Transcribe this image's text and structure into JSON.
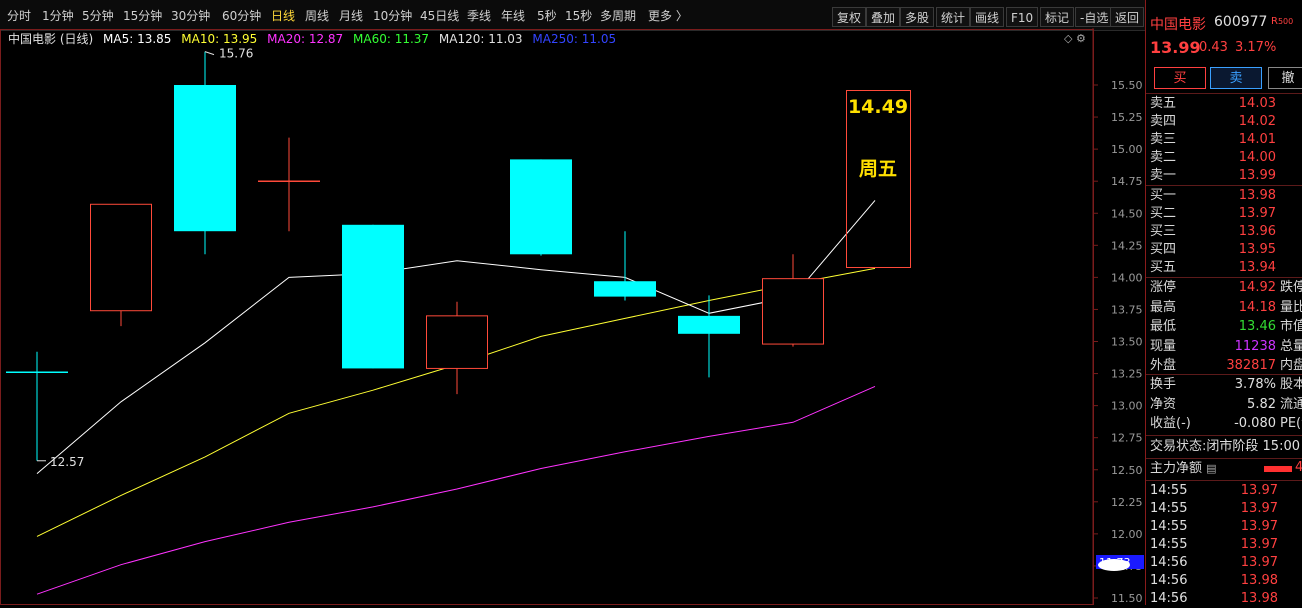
{
  "toolbar": {
    "tabs": [
      "分时",
      "1分钟",
      "5分钟",
      "15分钟",
      "30分钟",
      "60分钟",
      "日线",
      "周线",
      "月线",
      "10分钟",
      "45日线",
      "季线",
      "年线",
      "5秒",
      "15秒",
      "多周期",
      "更多 〉"
    ],
    "active_tab": "日线",
    "right_buttons": [
      "复权",
      "叠加",
      "多股",
      "统计",
      "画线",
      "F10",
      "标记",
      "-自选",
      "返回"
    ]
  },
  "legend": {
    "title": "中国电影 (日线)",
    "items": [
      {
        "text": "MA5: 13.85",
        "color": "#ffffff"
      },
      {
        "text": "MA10: 13.95",
        "color": "#ffff33"
      },
      {
        "text": "MA20: 12.87",
        "color": "#ff33ff"
      },
      {
        "text": "MA60: 11.37",
        "color": "#33ff33"
      },
      {
        "text": "MA120: 11.03",
        "color": "#e0e0e0"
      },
      {
        "text": "MA250: 11.05",
        "color": "#3333ff"
      }
    ]
  },
  "chart_data": {
    "type": "candlestick",
    "ylim": [
      11.5,
      15.75
    ],
    "y_ticks": [
      "15.50",
      "15.25",
      "15.00",
      "14.75",
      "14.50",
      "14.25",
      "14.00",
      "13.75",
      "13.50",
      "13.25",
      "13.00",
      "12.75",
      "12.50",
      "12.25",
      "12.00",
      "11.75",
      "11.50"
    ],
    "candles": [
      {
        "open": 12.57,
        "close": 13.26,
        "high": 13.42,
        "low": 12.57,
        "color": "cyan",
        "style": "cross"
      },
      {
        "open": 13.74,
        "close": 14.57,
        "high": 14.57,
        "low": 13.62,
        "color": "red"
      },
      {
        "open": 15.5,
        "close": 14.36,
        "high": 15.76,
        "low": 14.18,
        "color": "cyan"
      },
      {
        "open": 14.75,
        "close": 14.75,
        "high": 15.09,
        "low": 14.36,
        "color": "red",
        "style": "cross"
      },
      {
        "open": 14.41,
        "close": 13.29,
        "high": 14.41,
        "low": 13.29,
        "color": "cyan"
      },
      {
        "open": 13.29,
        "close": 13.7,
        "high": 13.81,
        "low": 13.09,
        "color": "red"
      },
      {
        "open": 14.92,
        "close": 14.18,
        "high": 14.92,
        "low": 14.17,
        "color": "cyan"
      },
      {
        "open": 13.97,
        "close": 13.85,
        "high": 14.36,
        "low": 13.82,
        "color": "cyan"
      },
      {
        "open": 13.7,
        "close": 13.56,
        "high": 13.86,
        "low": 13.22,
        "color": "cyan"
      },
      {
        "open": 13.48,
        "close": 13.99,
        "high": 14.18,
        "low": 13.46,
        "color": "red"
      }
    ],
    "ma5": [
      12.47,
      13.03,
      13.49,
      14.0,
      14.03,
      14.13,
      14.06,
      14.0,
      13.72,
      13.85,
      14.6
    ],
    "ma10": [
      11.98,
      12.3,
      12.6,
      12.94,
      13.12,
      13.32,
      13.54,
      13.68,
      13.82,
      13.95,
      14.07
    ],
    "ma20": [
      11.53,
      11.76,
      11.94,
      12.09,
      12.21,
      12.35,
      12.51,
      12.64,
      12.76,
      12.87,
      13.15
    ],
    "annotations": {
      "high_label": "15.76",
      "low_label": "12.57",
      "forecast_value": "14.49",
      "forecast_day": "周五"
    },
    "last_price_tag": "11.73"
  },
  "quote": {
    "name": "中国电影",
    "code": "600977",
    "badge": "R",
    "badge2": "500",
    "price": "13.99",
    "change": "0.43",
    "change_pct": "3.17%",
    "buy_btn": "买",
    "sell_btn": "卖",
    "cancel_btn": "撤",
    "asks": [
      {
        "label": "卖五",
        "price": "14.03"
      },
      {
        "label": "卖四",
        "price": "14.02"
      },
      {
        "label": "卖三",
        "price": "14.01"
      },
      {
        "label": "卖二",
        "price": "14.00"
      },
      {
        "label": "卖一",
        "price": "13.99"
      }
    ],
    "bids": [
      {
        "label": "买一",
        "price": "13.98"
      },
      {
        "label": "买二",
        "price": "13.97"
      },
      {
        "label": "买三",
        "price": "13.96"
      },
      {
        "label": "买四",
        "price": "13.95"
      },
      {
        "label": "买五",
        "price": "13.94"
      }
    ],
    "stats": [
      {
        "label": "涨停",
        "value": "14.92",
        "color": "#ff4040",
        "label2": "跌停"
      },
      {
        "label": "最高",
        "value": "14.18",
        "color": "#ff4040",
        "label2": "量比"
      },
      {
        "label": "最低",
        "value": "13.46",
        "color": "#33dd33",
        "label2": "市值"
      },
      {
        "label": "现量",
        "value": "11238",
        "color": "#cc33ff",
        "label2": "总量"
      },
      {
        "label": "外盘",
        "value": "382817",
        "color": "#ff4040",
        "label2": "内盘"
      }
    ],
    "stats2": [
      {
        "label": "换手",
        "value": "3.78%",
        "label2": "股本"
      },
      {
        "label": "净资",
        "value": "5.82",
        "label2": "流通"
      },
      {
        "label": "收益(-)",
        "value": "-0.080",
        "label2": "PE(动"
      }
    ],
    "status_label": "交易状态:",
    "status_value": "闭市阶段 15:00",
    "flow_label": "主力净额",
    "flow_value": "4",
    "ticks": [
      {
        "time": "14:55",
        "price": "13.97"
      },
      {
        "time": "14:55",
        "price": "13.97"
      },
      {
        "time": "14:55",
        "price": "13.97"
      },
      {
        "time": "14:55",
        "price": "13.97"
      },
      {
        "time": "14:56",
        "price": "13.97"
      },
      {
        "time": "14:56",
        "price": "13.98"
      },
      {
        "time": "14:56",
        "price": "13.98"
      }
    ]
  }
}
